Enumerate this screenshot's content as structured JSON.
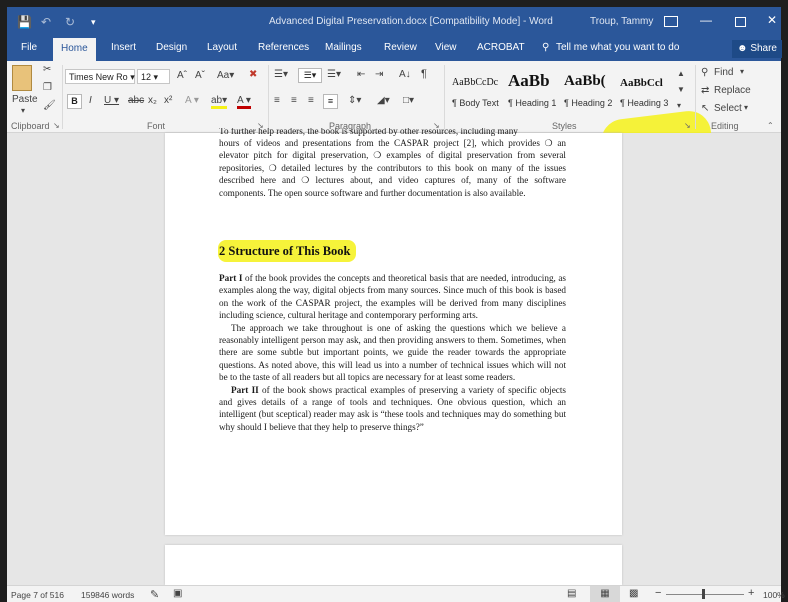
{
  "app": {
    "document_title": "Advanced Digital Preservation.docx [Compatibility Mode] - Word",
    "user": "Troup, Tammy"
  },
  "tabs": [
    "File",
    "Home",
    "Insert",
    "Design",
    "Layout",
    "References",
    "Mailings",
    "Review",
    "View",
    "ACROBAT"
  ],
  "tell_me": "Tell me what you want to do",
  "share": "Share",
  "clipboard": {
    "paste": "Paste",
    "group": "Clipboard"
  },
  "font": {
    "name": "Times New Ro",
    "size": "12",
    "group": "Font"
  },
  "paragraph": {
    "group": "Paragraph"
  },
  "styles": {
    "group": "Styles",
    "items": [
      {
        "preview": "AaBbCcDc",
        "name": "¶ Body Text"
      },
      {
        "preview": "AaBb",
        "name": "¶ Heading 1"
      },
      {
        "preview": "AaBb(",
        "name": "¶ Heading 2"
      },
      {
        "preview": "AaBbCcl",
        "name": "¶ Heading 3"
      }
    ]
  },
  "editing": {
    "find": "Find",
    "replace": "Replace",
    "select": "Select",
    "group": "Editing"
  },
  "document": {
    "intro_cut": "To further help readers, the book is supported by other resources, including many",
    "intro": "hours of videos and presentations from the CASPAR project [2], which provides ❍ an elevator pitch for digital preservation, ❍ examples of digital preservation from several repositories, ❍ detailed lectures by the contributors to this book on many of the issues described here and ❍ lectures about, and video captures of, many of the software components. The open source software and further documentation is also available.",
    "heading": "2  Structure of This Book",
    "p1_bold": "Part I",
    "p1": " of the book provides the concepts and theoretical basis that are needed, introducing, as examples along the way, digital objects from many sources. Since much of this book is based on the work of the CASPAR  project, the examples will be derived from many disciplines including science, cultural heritage and contemporary performing arts.",
    "p2": "The approach we take throughout is one of asking the questions which we believe a reasonably intelligent person may ask, and then providing answers to them. Sometimes, when there are some subtle but important points, we guide the reader towards the appropriate questions. As noted above, this will lead us into a number of technical issues which will not be to the taste of all readers but all topics are necessary for at least some readers.",
    "p3_bold": "Part II",
    "p3": " of the book shows practical examples of preserving a variety of specific objects and gives details of a range of tools and techniques. One obvious question, which an intelligent (but sceptical) reader may ask is “these tools and techniques may do something but why should I believe that they help to preserve things?”"
  },
  "status": {
    "page": "Page 7 of 516",
    "words": "159846 words",
    "zoom": "100%"
  },
  "colors": {
    "word_blue": "#2b579a",
    "highlight": "#f5f117"
  }
}
